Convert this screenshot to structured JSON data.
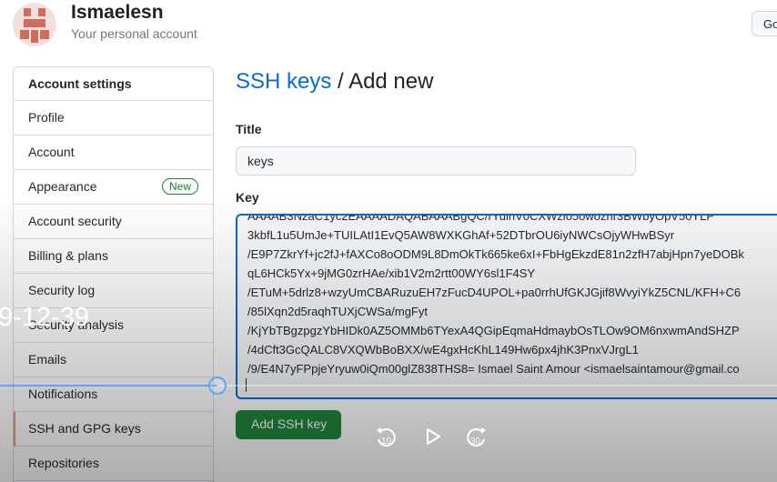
{
  "header": {
    "username": "Ismaelesn",
    "subtitle": "Your personal account",
    "goto_button": "Go"
  },
  "sidebar": {
    "heading": "Account settings",
    "items": [
      {
        "label": "Profile"
      },
      {
        "label": "Account"
      },
      {
        "label": "Appearance",
        "badge": "New"
      },
      {
        "label": "Account security"
      },
      {
        "label": "Billing & plans"
      },
      {
        "label": "Security log"
      },
      {
        "label": "Security analysis"
      },
      {
        "label": "Emails"
      },
      {
        "label": "Notifications"
      },
      {
        "label": "SSH and GPG keys"
      },
      {
        "label": "Repositories"
      }
    ]
  },
  "main": {
    "breadcrumb_link": "SSH keys",
    "breadcrumb_sep": " / ",
    "breadcrumb_current": "Add new",
    "title_label": "Title",
    "title_value": "keys",
    "key_label": "Key",
    "key_lines": [
      "AAAAB3NzaC1yc2EAAAADAQABAAABgQC/rYulhV0CXWzlo5owozhr3BWbyOpV50YLP",
      "3kbfL1u5UmJe+TUILAtI1EvQ5AW8WXKGhAf+52DTbrOU6iyNWCsOjyWHwBSyr",
      "/E9P7ZkrYf+jc2fJ+fAXCo8oODM9L8DmOkTk665ke6xI+FbHgEkzdE81n2zfH7abjHpn7yeDOBk",
      "qL6HCk5Yx+9jMG0zrHAe/xib1V2m2rtt00WY6sl1F4SY",
      "/ETuM+5drlz8+wzyUmCBARuzuEH7zFucD4UPOL+pa0rrhUfGKJGjif8WvyiYkZ5CNL/KFH+C6",
      "/85lXqn2d5raqhTUXjCWSa/mgFyt",
      "/KjYbTBgzpgzYbHIDk0AZ5OMMb6TYexA4QGipEqmaHdmaybOsTLOw9OM6nxwmAndSHZP",
      "/4dCft3GcQALC8VXQWbBoBXX/wE4gxHcKhL149Hw6px4jhK3PnxVJrgL1",
      "/9/E4N7yFPpjeYryuw0iQm00glZ838THS8= Ismael Saint Amour <ismaelsaintamour@gmail.co"
    ],
    "add_button": "Add SSH key"
  },
  "video": {
    "timestamp": "9-12-39",
    "progress": 0.28,
    "rewind_seconds": "10",
    "forward_seconds": "30"
  },
  "colors": {
    "link": "#0969da",
    "primary_button": "#1f883d",
    "focus_border": "#0969da",
    "badge_green": "#1a7f37",
    "seek_bar": "#5fa3ff"
  }
}
